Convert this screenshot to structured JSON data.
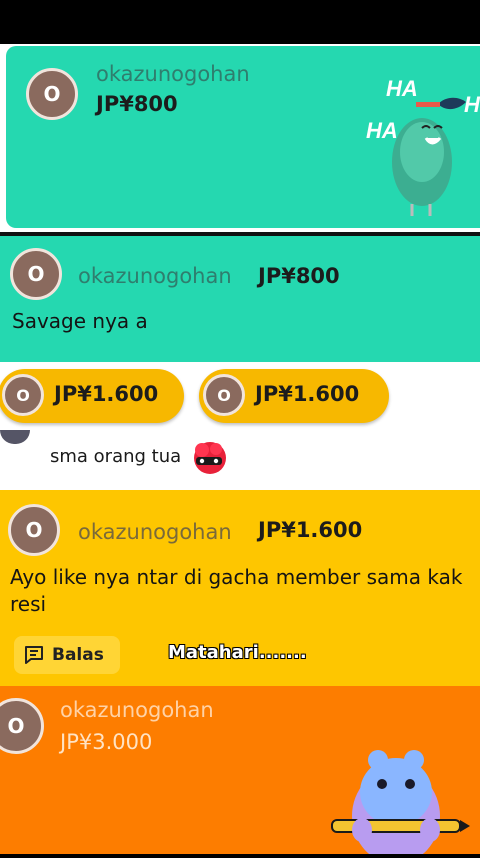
{
  "card1": {
    "avatar": "O",
    "username": "okazunogohan",
    "amount": "JP¥800",
    "sticker_text_1": "HA",
    "sticker_text_2": "HA",
    "sticker_text_3": "H"
  },
  "card2": {
    "avatar": "O",
    "username": "okazunogohan",
    "amount": "JP¥800",
    "message": "Savage nya a"
  },
  "gift_pills": [
    {
      "avatar": "O",
      "amount": "JP¥1.600"
    },
    {
      "avatar": "O",
      "amount": "JP¥1.600"
    }
  ],
  "chat_line": {
    "text": "sma orang tua"
  },
  "card3": {
    "avatar": "O",
    "username": "okazunogohan",
    "amount": "JP¥1.600",
    "message": "Ayo like nya ntar di gacha member sama kak resi",
    "reply_label": "Balas",
    "caption": "Matahari......."
  },
  "card4": {
    "avatar": "O",
    "username": "okazunogohan",
    "amount": "JP¥3.000"
  },
  "colors": {
    "teal": "#25d8b0",
    "yellow": "#fec600",
    "orange": "#fd7d00",
    "avatar_brown": "#8a6a5e"
  }
}
